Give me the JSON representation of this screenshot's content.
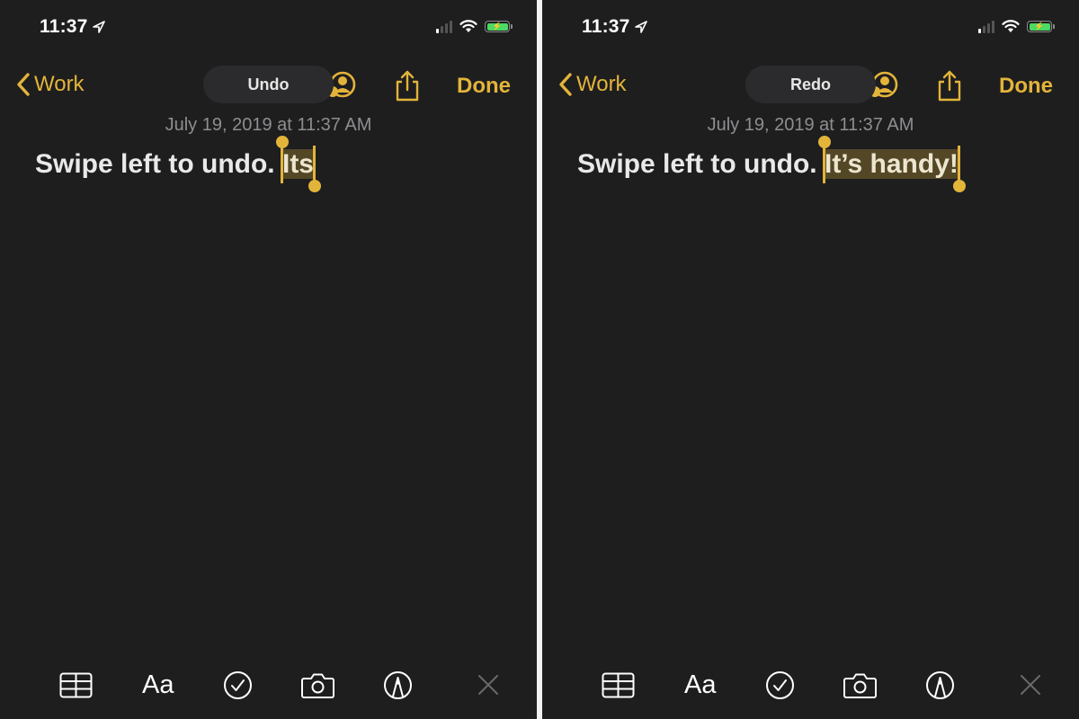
{
  "panels": [
    {
      "status": {
        "time": "11:37",
        "location_icon": "location-arrow-icon",
        "signal_bars_on": 1,
        "signal_bars_total": 4,
        "wifi_icon": "wifi-icon",
        "battery_icon": "battery-charging-icon"
      },
      "nav": {
        "back_label": "Work",
        "pill_label": "Undo",
        "done_label": "Done"
      },
      "note": {
        "date": "July 19, 2019 at 11:37 AM",
        "text_before": "Swipe left to undo. ",
        "selected_text": "Its"
      },
      "toolbar": {
        "items": [
          "table-icon",
          "Aa",
          "checklist-icon",
          "camera-icon",
          "markup-icon",
          "close-icon"
        ]
      }
    },
    {
      "status": {
        "time": "11:37",
        "location_icon": "location-arrow-icon",
        "signal_bars_on": 1,
        "signal_bars_total": 4,
        "wifi_icon": "wifi-icon",
        "battery_icon": "battery-charging-icon"
      },
      "nav": {
        "back_label": "Work",
        "pill_label": "Redo",
        "done_label": "Done"
      },
      "note": {
        "date": "July 19, 2019 at 11:37 AM",
        "text_before": "Swipe left to undo. ",
        "selected_text": "It’s handy!"
      },
      "toolbar": {
        "items": [
          "table-icon",
          "Aa",
          "checklist-icon",
          "camera-icon",
          "markup-icon",
          "close-icon"
        ]
      }
    }
  ],
  "colors": {
    "accent": "#e3b43a",
    "background": "#1e1e1f",
    "text": "#e9e9ea",
    "date_text": "#8e8e91",
    "battery": "#4cd964"
  }
}
